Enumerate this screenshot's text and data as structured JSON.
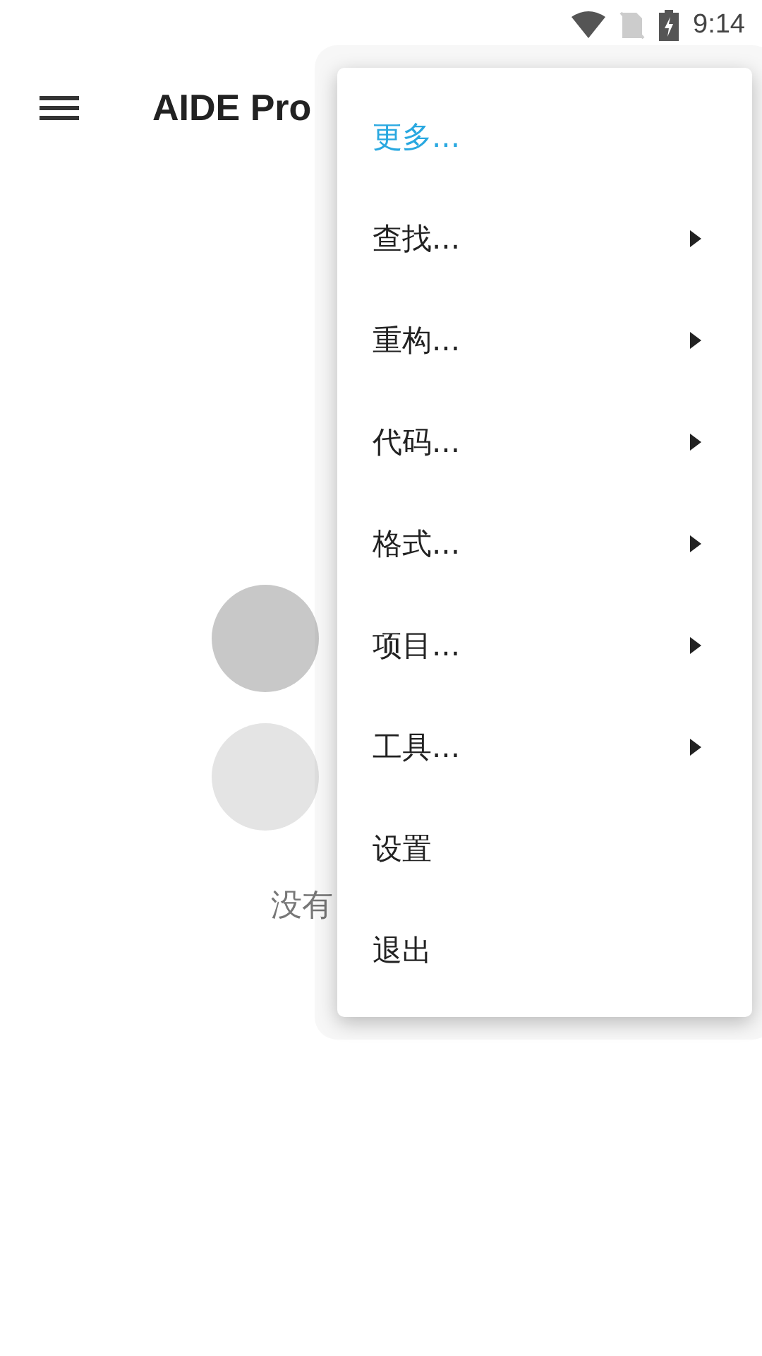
{
  "status_bar": {
    "time": "9:14"
  },
  "app_bar": {
    "title": "AIDE Pro"
  },
  "empty_state": {
    "message": "没有"
  },
  "menu": {
    "items": [
      {
        "label": "更多...",
        "kind": "link"
      },
      {
        "label": "查找...",
        "kind": "submenu"
      },
      {
        "label": "重构...",
        "kind": "submenu"
      },
      {
        "label": "代码...",
        "kind": "submenu"
      },
      {
        "label": "格式...",
        "kind": "submenu"
      },
      {
        "label": "项目...",
        "kind": "submenu"
      },
      {
        "label": "工具...",
        "kind": "submenu"
      },
      {
        "label": "设置",
        "kind": "action"
      },
      {
        "label": "退出",
        "kind": "action"
      }
    ]
  }
}
